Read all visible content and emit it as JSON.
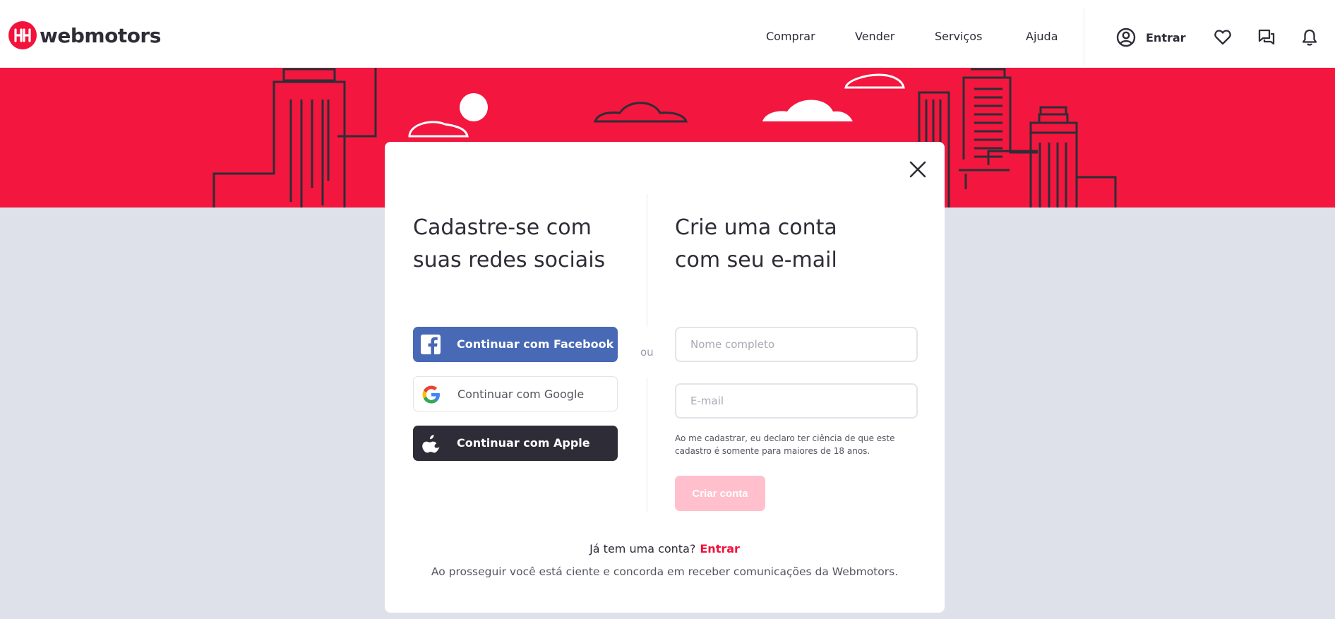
{
  "brand": {
    "name": "webmotors",
    "accent": "#f3123c",
    "dark": "#2e2d37"
  },
  "header": {
    "nav": [
      "Comprar",
      "Vender",
      "Serviços",
      "Ajuda"
    ],
    "login_label": "Entrar",
    "icons": [
      "user-circle-icon",
      "heart-icon",
      "chat-icon",
      "bell-icon"
    ]
  },
  "modal": {
    "social_title_line1": "Cadastre-se com",
    "social_title_line2": "suas redes sociais",
    "email_title_line1": "Crie uma conta",
    "email_title_line2": "com seu e-mail",
    "or_label": "ou",
    "facebook_label": "Continuar com Facebook",
    "google_label": "Continuar com Google",
    "apple_label": "Continuar com Apple",
    "name_placeholder": "Nome completo",
    "email_placeholder": "E-mail",
    "disclaimer": "Ao me cadastrar, eu declaro ter ciência de que este cadastro é somente para maiores de 18 anos.",
    "create_label": "Criar conta",
    "have_account": "Já tem uma conta?",
    "login_link": "Entrar",
    "consent": "Ao prosseguir você está ciente e concorda em receber comunicações da Webmotors."
  }
}
